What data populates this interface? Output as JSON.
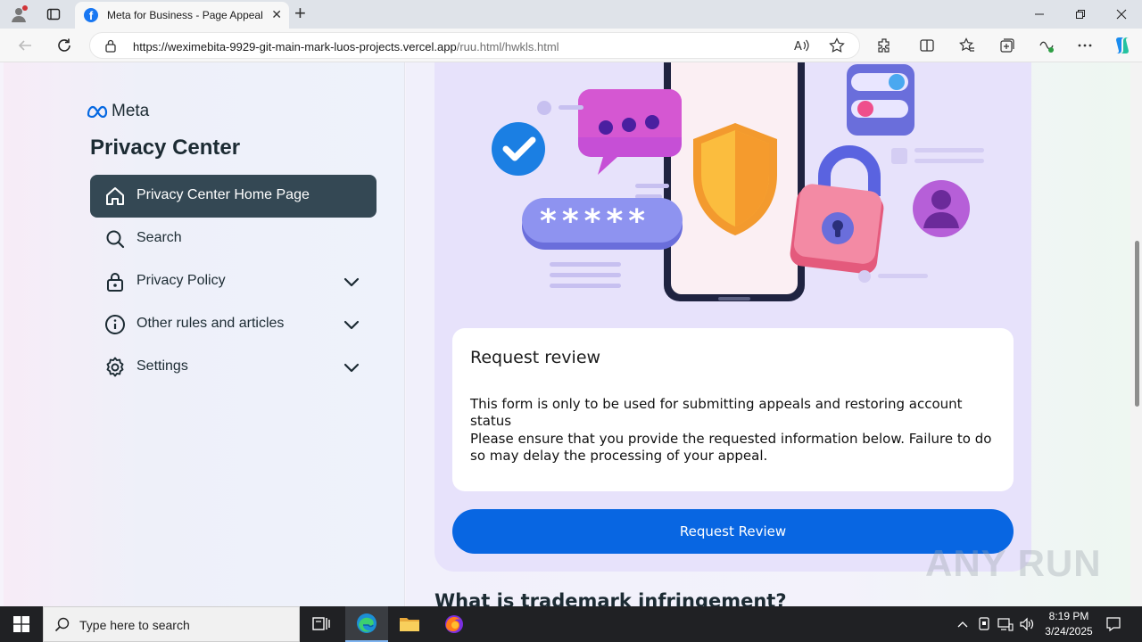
{
  "browser": {
    "tab_title": "Meta for Business - Page Appeal",
    "tab_favicon": "facebook-icon",
    "url_host": "https://weximebita-9929-git-main-mark-luos-projects.vercel.app",
    "url_path": "/ruu.html/hwkls.html"
  },
  "sidebar": {
    "brand": "Meta",
    "title": "Privacy Center",
    "items": [
      {
        "label": "Privacy Center Home Page",
        "icon": "home-icon",
        "active": true,
        "expandable": false
      },
      {
        "label": "Search",
        "icon": "search-icon",
        "active": false,
        "expandable": false
      },
      {
        "label": "Privacy Policy",
        "icon": "lock-icon",
        "active": false,
        "expandable": true
      },
      {
        "label": "Other rules and articles",
        "icon": "info-icon",
        "active": false,
        "expandable": true
      },
      {
        "label": "Settings",
        "icon": "gear-icon",
        "active": false,
        "expandable": true
      }
    ]
  },
  "main": {
    "illustration_stars": "*****",
    "review": {
      "heading": "Request review",
      "paragraph1": "This form is only to be used for submitting appeals and restoring account status",
      "paragraph2": "Please ensure that you provide the requested information below. Failure to do so may delay the processing of your appeal."
    },
    "button_label": "Request Review",
    "next_heading": "What is trademark infringement?"
  },
  "watermark": "ANY RUN",
  "taskbar": {
    "search_placeholder": "Type here to search",
    "time": "8:19 PM",
    "date": "3/24/2025"
  },
  "colors": {
    "accent_blue": "#0866e2",
    "active_nav": "#344854",
    "card_bg": "#e7e2fb"
  }
}
